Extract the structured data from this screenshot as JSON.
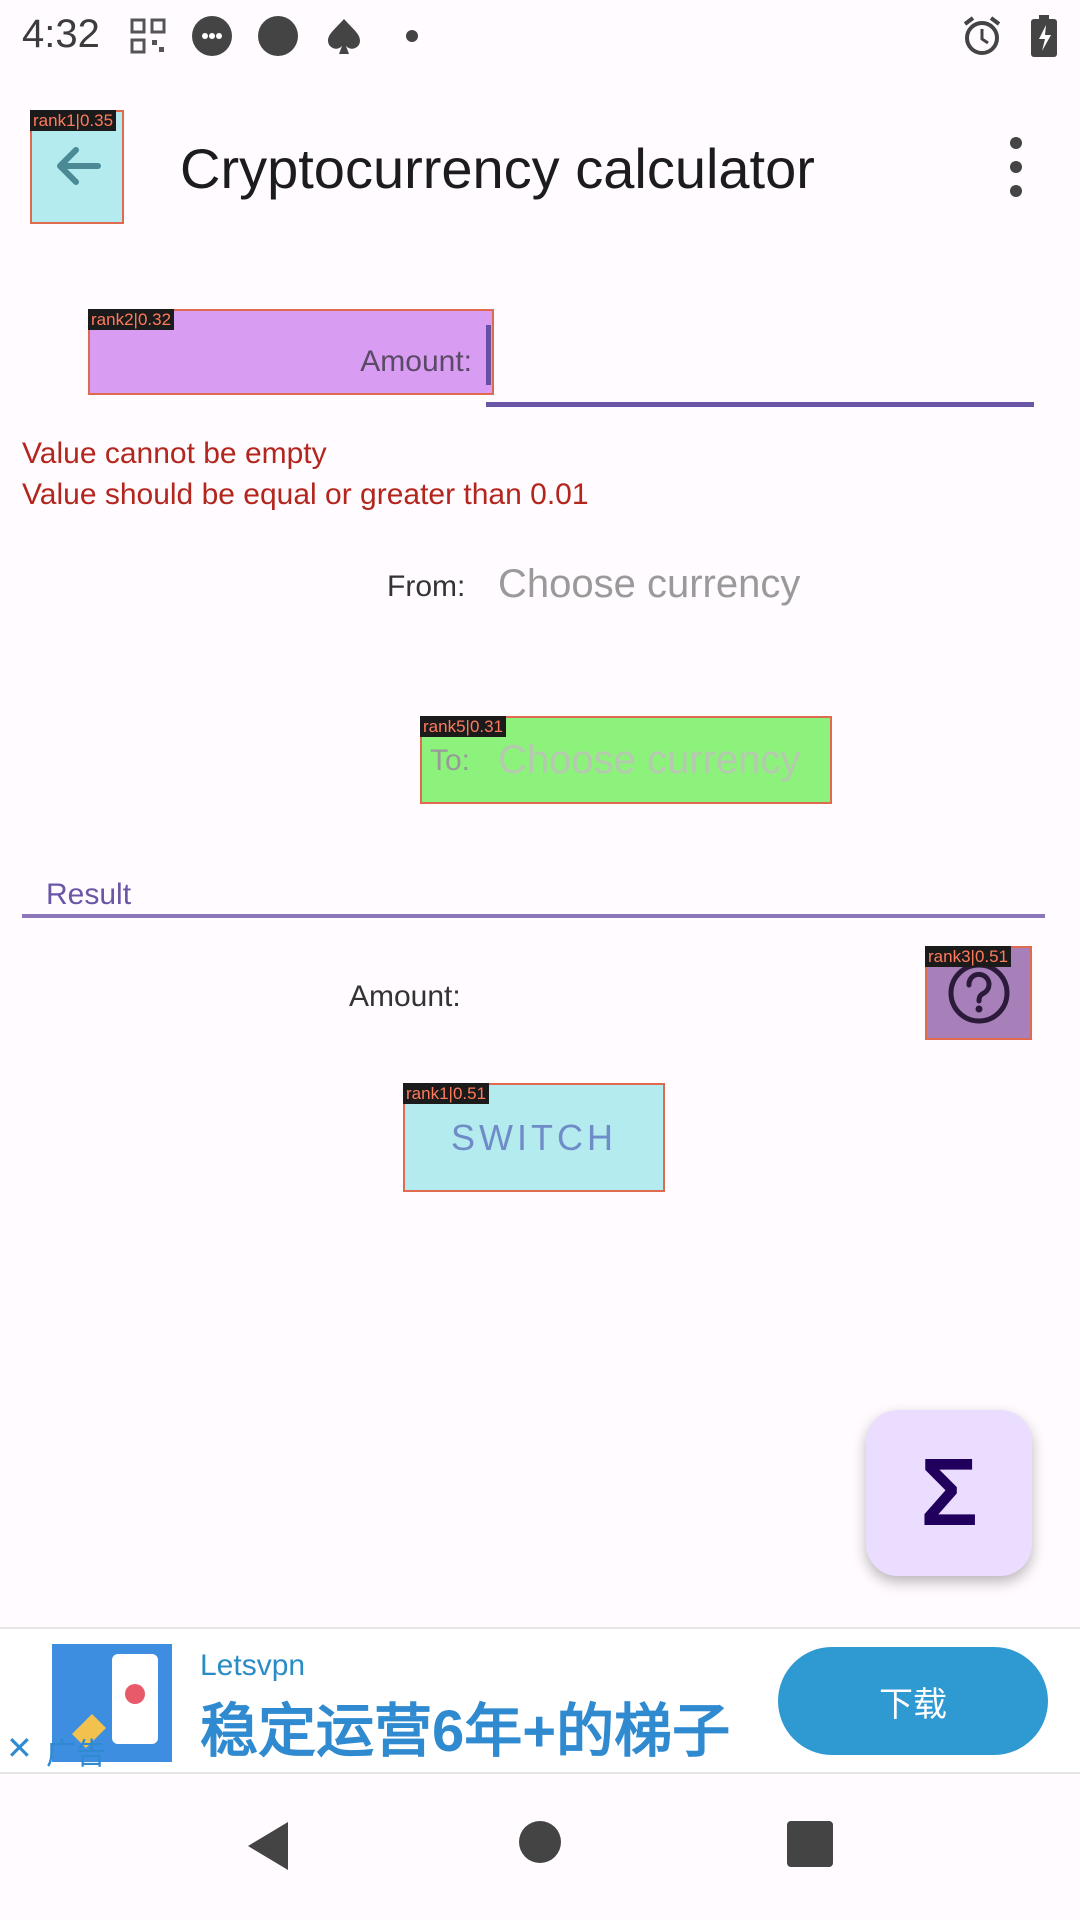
{
  "status_bar": {
    "time": "4:32"
  },
  "overlays": {
    "back": "rank1|0.35",
    "amount": "rank2|0.32",
    "to": "rank5|0.31",
    "help": "rank3|0.51",
    "switch": "rank1|0.51"
  },
  "app_bar": {
    "title": "Cryptocurrency calculator"
  },
  "form": {
    "amount_label": "Amount:",
    "errors": [
      "Value cannot be empty",
      "Value should be equal or greater than 0.01"
    ],
    "from_label": "From:",
    "from_placeholder": "Choose currency",
    "to_label": "To:",
    "to_placeholder": "Choose currency"
  },
  "result": {
    "label": "Result",
    "amount_label": "Amount:"
  },
  "buttons": {
    "switch": "SWITCH",
    "fab_symbol": "Σ"
  },
  "ad": {
    "brand": "Letsvpn",
    "slogan": "稳定运营6年+的梯子",
    "cta": "下载",
    "tag": "广告"
  },
  "colors": {
    "primary": "#6750a4",
    "error": "#b3261e",
    "fab_bg": "#eaddff"
  }
}
